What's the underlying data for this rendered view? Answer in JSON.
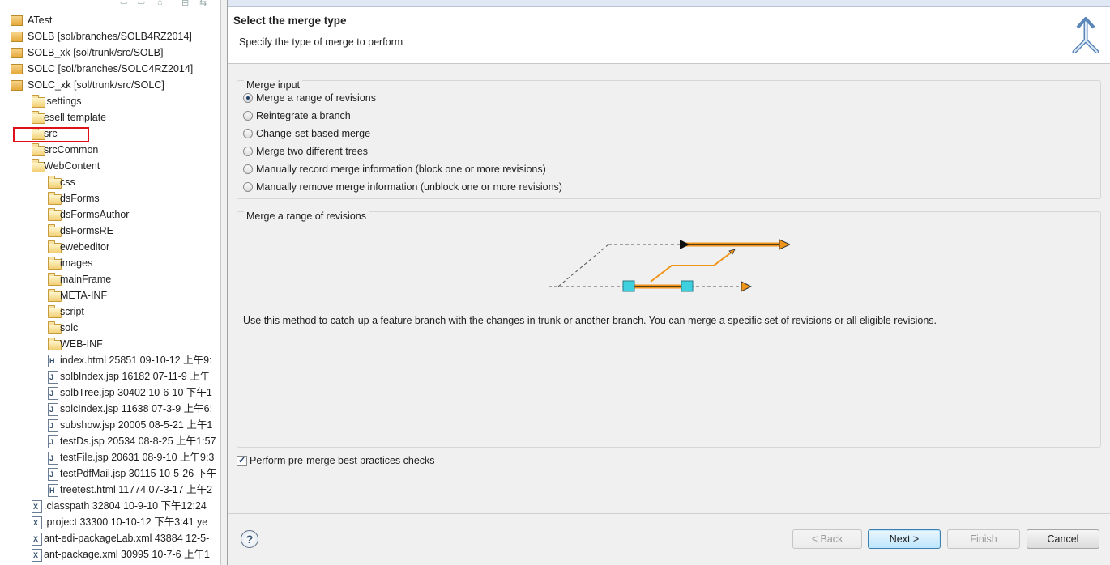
{
  "explorer": {
    "items": [
      {
        "label": "ATest",
        "indent": 0,
        "icon": "project-icon"
      },
      {
        "label": "SOLB [sol/branches/SOLB4RZ2014]",
        "indent": 0,
        "icon": "svn-project-icon"
      },
      {
        "label": "SOLB_xk [sol/trunk/src/SOLB]",
        "indent": 0,
        "icon": "svn-project-icon"
      },
      {
        "label": "SOLC [sol/branches/SOLC4RZ2014]",
        "indent": 0,
        "icon": "svn-project-icon"
      },
      {
        "label": "SOLC_xk [sol/trunk/src/SOLC]",
        "indent": 0,
        "icon": "svn-project-icon"
      },
      {
        "label": ".settings",
        "indent": 1,
        "icon": "folder-icon"
      },
      {
        "label": "esell template",
        "indent": 1,
        "icon": "folder-icon"
      },
      {
        "label": "src",
        "indent": 1,
        "icon": "source-folder-icon"
      },
      {
        "label": "srcCommon",
        "indent": 1,
        "icon": "folder-icon"
      },
      {
        "label": "WebContent",
        "indent": 1,
        "icon": "folder-icon"
      },
      {
        "label": "css",
        "indent": 2,
        "icon": "folder-icon"
      },
      {
        "label": "dsForms",
        "indent": 2,
        "icon": "folder-icon"
      },
      {
        "label": "dsFormsAuthor",
        "indent": 2,
        "icon": "folder-icon"
      },
      {
        "label": "dsFormsRE",
        "indent": 2,
        "icon": "folder-icon"
      },
      {
        "label": "ewebeditor",
        "indent": 2,
        "icon": "folder-icon"
      },
      {
        "label": "images",
        "indent": 2,
        "icon": "folder-icon"
      },
      {
        "label": "mainFrame",
        "indent": 2,
        "icon": "folder-icon"
      },
      {
        "label": "META-INF",
        "indent": 2,
        "icon": "folder-icon"
      },
      {
        "label": "script",
        "indent": 2,
        "icon": "folder-icon"
      },
      {
        "label": "solc",
        "indent": 2,
        "icon": "folder-icon"
      },
      {
        "label": "WEB-INF",
        "indent": 2,
        "icon": "folder-icon"
      },
      {
        "label": "index.html 25851  09-10-12 上午9:",
        "indent": 2,
        "icon": "html-file-icon"
      },
      {
        "label": "solbIndex.jsp 16182  07-11-9 上午",
        "indent": 2,
        "icon": "jsp-file-icon"
      },
      {
        "label": "solbTree.jsp 30402  10-6-10 下午1",
        "indent": 2,
        "icon": "jsp-file-icon"
      },
      {
        "label": "solcIndex.jsp 11638  07-3-9 上午6:",
        "indent": 2,
        "icon": "jsp-file-icon"
      },
      {
        "label": "subshow.jsp 20005  08-5-21 上午1",
        "indent": 2,
        "icon": "jsp-file-icon"
      },
      {
        "label": "testDs.jsp 20534  08-8-25 上午1:57",
        "indent": 2,
        "icon": "jsp-file-icon"
      },
      {
        "label": "testFile.jsp 20631  08-9-10 上午9:3",
        "indent": 2,
        "icon": "jsp-file-icon"
      },
      {
        "label": "testPdfMail.jsp 30115  10-5-26 下午",
        "indent": 2,
        "icon": "jsp-file-icon"
      },
      {
        "label": "treetest.html 11774  07-3-17 上午2",
        "indent": 2,
        "icon": "html-file-icon"
      },
      {
        "label": ".classpath 32804  10-9-10 下午12:24",
        "indent": 1,
        "icon": "xml-file-icon"
      },
      {
        "label": ".project 33300  10-10-12 下午3:41  ye",
        "indent": 1,
        "icon": "xml-file-icon"
      },
      {
        "label": "ant-edi-packageLab.xml 43884  12-5-",
        "indent": 1,
        "icon": "xml-file-icon"
      },
      {
        "label": "ant-package.xml 30995  10-7-6 上午1",
        "indent": 1,
        "icon": "xml-file-icon"
      }
    ]
  },
  "wizard": {
    "title": "Select the merge type",
    "description": "Specify the type of merge to perform",
    "merge_input": {
      "group_label": "Merge input",
      "options": [
        {
          "label": "Merge a range of revisions",
          "selected": true
        },
        {
          "label": "Reintegrate a branch",
          "selected": false
        },
        {
          "label": "Change-set based merge",
          "selected": false
        },
        {
          "label": "Merge two different trees",
          "selected": false
        },
        {
          "label": "Manually record merge information (block one or more revisions)",
          "selected": false
        },
        {
          "label": "Manually remove merge information (unblock one or more revisions)",
          "selected": false
        }
      ]
    },
    "details": {
      "group_label": "Merge a range of revisions",
      "description": "Use this method to catch-up a feature branch with the changes in trunk or another branch.  You can merge a specific set of revisions or all eligible revisions."
    },
    "checkbox": {
      "label": "Perform pre-merge best practices checks",
      "checked": true
    },
    "buttons": {
      "help": "?",
      "back": "< Back",
      "next": "Next >",
      "finish": "Finish",
      "cancel": "Cancel"
    },
    "accent_color": "#f0941a"
  }
}
